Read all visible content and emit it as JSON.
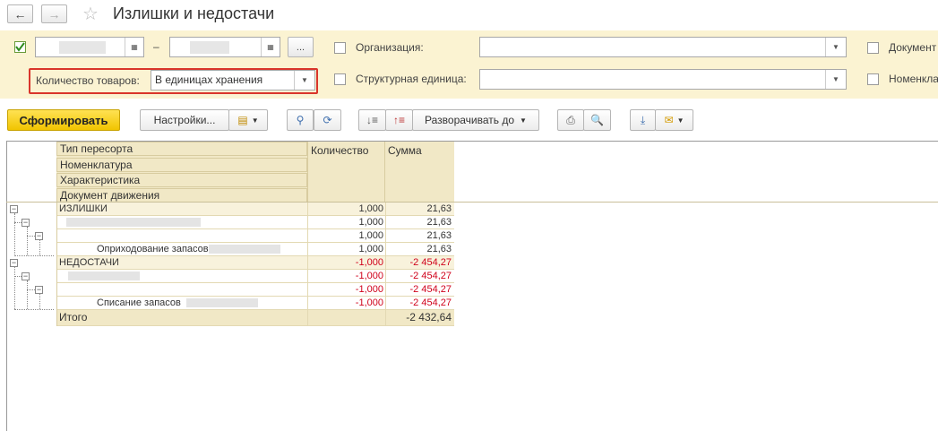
{
  "header": {
    "back_icon": "←",
    "forward_icon": "→",
    "star_icon": "☆",
    "title": "Излишки и недостачи"
  },
  "filters": {
    "period_dash": "–",
    "ellipsis_label": "...",
    "org_label": "Организация:",
    "doc_label": "Документ",
    "qty_label": "Количество товаров:",
    "qty_value": "В единицах хранения",
    "unit_label": "Структурная единица:",
    "nomen_label": "Номенкла"
  },
  "toolbar": {
    "generate_label": "Сформировать",
    "settings_label": "Настройки...",
    "expand_label": "Разворачивать до"
  },
  "report": {
    "headers": [
      "Тип пересорта",
      "Номенклатура",
      "Характеристика",
      "Документ движения"
    ],
    "col_qty": "Количество",
    "col_sum": "Сумма",
    "rows": [
      {
        "label": "ИЗЛИШКИ",
        "qty": "1,000",
        "sum": "21,63"
      },
      {
        "label": "",
        "qty": "1,000",
        "sum": "21,63"
      },
      {
        "label": "",
        "qty": "1,000",
        "sum": "21,63"
      },
      {
        "label": "Оприходование запасов",
        "qty": "1,000",
        "sum": "21,63"
      },
      {
        "label": "НЕДОСТАЧИ",
        "qty": "-1,000",
        "sum": "-2 454,27"
      },
      {
        "label": "",
        "qty": "-1,000",
        "sum": "-2 454,27"
      },
      {
        "label": "",
        "qty": "-1,000",
        "sum": "-2 454,27"
      },
      {
        "label": "Списание запасов",
        "qty": "-1,000",
        "sum": "-2 454,27"
      }
    ],
    "total_label": "Итого",
    "total_sum": "-2 432,64"
  },
  "colors": {
    "accent_yellow": "#f1c400",
    "highlight_red": "#d9352b",
    "panel_bg": "#fbf3d2",
    "negative": "#d0021b"
  }
}
